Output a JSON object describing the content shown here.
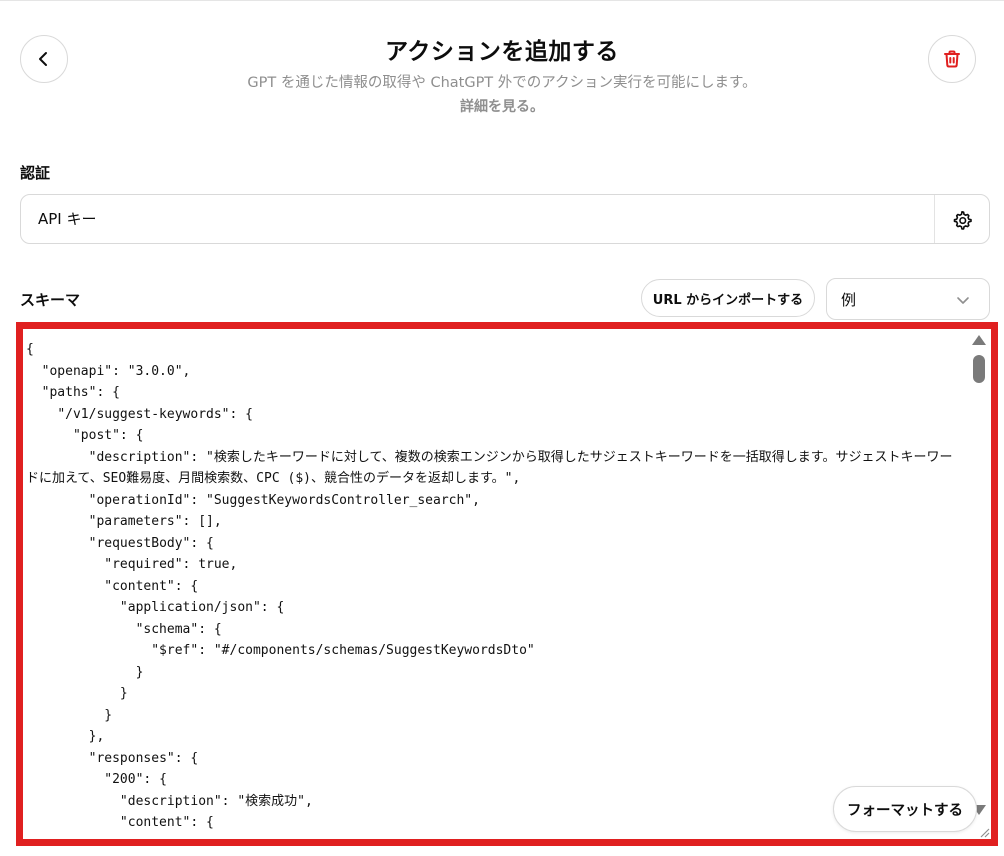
{
  "header": {
    "title": "アクションを追加する",
    "subtitle": "GPT を通じた情報の取得や ChatGPT 外でのアクション実行を可能にします。",
    "learn_more": "詳細を見る。"
  },
  "icons": {
    "back": "chevron-left-icon",
    "delete": "trash-icon",
    "settings": "gear-icon",
    "dropdown": "chevron-down-icon"
  },
  "colors": {
    "delete_accent": "#e02020",
    "highlight_border": "#e02020"
  },
  "auth": {
    "label": "認証",
    "value": "API キー"
  },
  "schema": {
    "label": "スキーマ",
    "import_label": "URL からインポートする",
    "example_value": "例",
    "format_label": "フォーマットする",
    "code": "{\n  \"openapi\": \"3.0.0\",\n  \"paths\": {\n    \"/v1/suggest-keywords\": {\n      \"post\": {\n        \"description\": \"検索したキーワードに対して、複数の検索エンジンから取得したサジェストキーワードを一括取得します。サジェストキーワードに加えて、SEO難易度、月間検索数、CPC ($)、競合性のデータを返却します。\",\n        \"operationId\": \"SuggestKeywordsController_search\",\n        \"parameters\": [],\n        \"requestBody\": {\n          \"required\": true,\n          \"content\": {\n            \"application/json\": {\n              \"schema\": {\n                \"$ref\": \"#/components/schemas/SuggestKeywordsDto\"\n              }\n            }\n          }\n        },\n        \"responses\": {\n          \"200\": {\n            \"description\": \"検索成功\",\n            \"content\": {"
  }
}
